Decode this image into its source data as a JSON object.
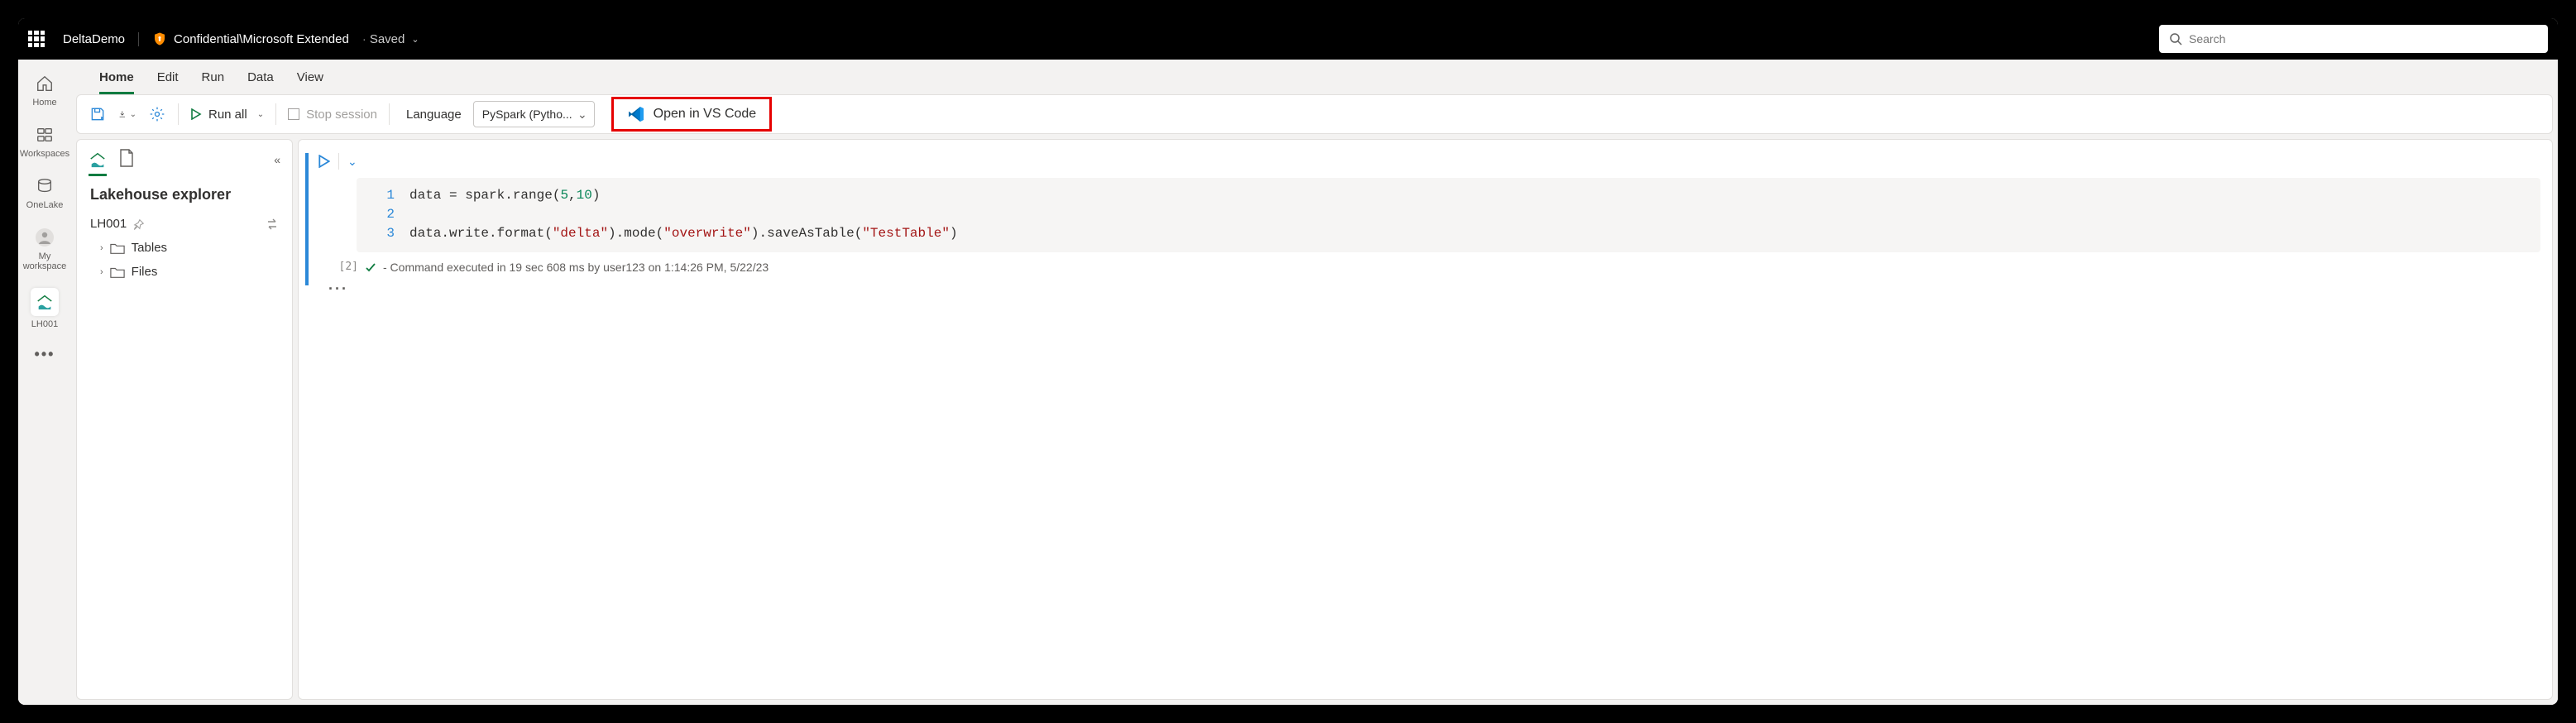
{
  "header": {
    "brand": "DeltaDemo",
    "sensitivity": "Confidential\\Microsoft Extended",
    "saved": "Saved",
    "search_placeholder": "Search"
  },
  "left_rail": {
    "items": [
      {
        "name": "home",
        "label": "Home"
      },
      {
        "name": "workspaces",
        "label": "Workspaces"
      },
      {
        "name": "onelake",
        "label": "OneLake"
      },
      {
        "name": "my-workspace",
        "label": "My workspace"
      },
      {
        "name": "lh001",
        "label": "LH001"
      }
    ]
  },
  "menu": {
    "tabs": [
      "Home",
      "Edit",
      "Run",
      "Data",
      "View"
    ],
    "active": "Home"
  },
  "toolbar": {
    "run_all": "Run all",
    "stop_session": "Stop session",
    "language_label": "Language",
    "language_value": "PySpark (Pytho...",
    "open_vscode": "Open in VS Code"
  },
  "explorer": {
    "title": "Lakehouse explorer",
    "lakehouse": "LH001",
    "tree": [
      {
        "label": "Tables"
      },
      {
        "label": "Files"
      }
    ]
  },
  "cell": {
    "exec_count": "[2]",
    "lines": [
      {
        "n": "1",
        "tokens": [
          {
            "t": "data = spark.range("
          },
          {
            "t": "5",
            "c": "num"
          },
          {
            "t": ","
          },
          {
            "t": "10",
            "c": "num"
          },
          {
            "t": ")"
          }
        ]
      },
      {
        "n": "2",
        "tokens": []
      },
      {
        "n": "3",
        "tokens": [
          {
            "t": "data.write.format("
          },
          {
            "t": "\"delta\"",
            "c": "str"
          },
          {
            "t": ").mode("
          },
          {
            "t": "\"overwrite\"",
            "c": "str"
          },
          {
            "t": ").saveAsTable("
          },
          {
            "t": "\"TestTable\"",
            "c": "str"
          },
          {
            "t": ")"
          }
        ]
      }
    ],
    "output_status": "- Command executed in 19 sec 608 ms by user123 on 1:14:26 PM, 5/22/23"
  }
}
